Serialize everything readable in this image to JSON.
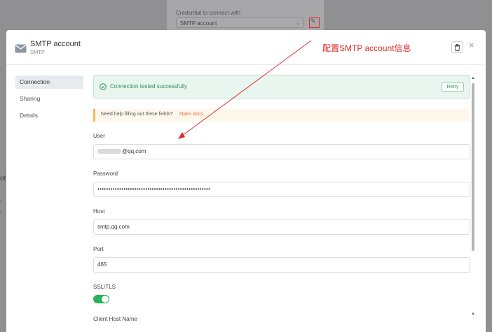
{
  "background": {
    "credential_label": "Credential to connect with",
    "credential_select_value": "SMTP account",
    "side_title": "ot"
  },
  "modal": {
    "title": "SMTP account",
    "subtitle": "SMTP",
    "close_glyph": "×",
    "nav": [
      {
        "label": "Connection",
        "active": true
      },
      {
        "label": "Sharing",
        "active": false
      },
      {
        "label": "Details",
        "active": false
      }
    ],
    "alert": {
      "text": "Connection tested successfully",
      "button": "Retry",
      "color": "#2f8f5a"
    },
    "help": {
      "text": "Need help filling out these fields?",
      "link": "Open docs"
    },
    "fields": {
      "user": {
        "label": "User",
        "value_visible": "@qq.com"
      },
      "password": {
        "label": "Password",
        "value": "••••••••••••••••••••••••••••••••••••••••••••••••••••"
      },
      "host": {
        "label": "Host",
        "value": "smtp.qq.com"
      },
      "port": {
        "label": "Port",
        "value": "465"
      },
      "ssl": {
        "label": "SSL/TLS",
        "enabled": true
      },
      "client_host": {
        "label": "Client Host Name"
      }
    }
  },
  "annotation": {
    "text": "配置SMTP account信息",
    "color": "#e02b2b"
  },
  "colors": {
    "accent_green": "#28b45a",
    "link_orange": "#e6663f",
    "annotation_red": "#e02b2b"
  }
}
